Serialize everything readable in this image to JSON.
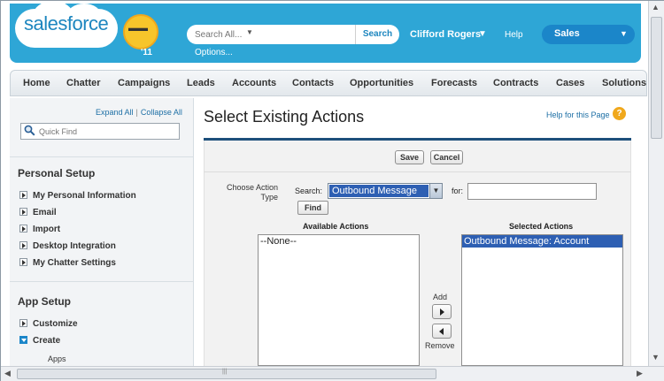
{
  "header": {
    "logo_text": "salesforce",
    "logo_year": "'11",
    "search_placeholder": "Search All...",
    "search_button": "Search",
    "options_link": "Options...",
    "user_name": "Clifford Rogers",
    "help_link": "Help",
    "app_picker": "Sales"
  },
  "tabs": [
    "Home",
    "Chatter",
    "Campaigns",
    "Leads",
    "Accounts",
    "Contacts",
    "Opportunities",
    "Forecasts",
    "Contracts",
    "Cases",
    "Solutions"
  ],
  "sidebar": {
    "expand_all": "Expand All",
    "separator": "|",
    "collapse_all": "Collapse All",
    "quick_find_placeholder": "Quick Find",
    "personal_setup": {
      "title": "Personal Setup",
      "items": [
        "My Personal Information",
        "Email",
        "Import",
        "Desktop Integration",
        "My Chatter Settings"
      ]
    },
    "app_setup": {
      "title": "App Setup",
      "items": [
        "Customize",
        "Create"
      ],
      "sub_items": [
        "Apps"
      ]
    }
  },
  "main": {
    "title": "Select Existing Actions",
    "help_link": "Help for this Page",
    "help_icon": "?",
    "save_button": "Save",
    "cancel_button": "Cancel",
    "choose_label": "Choose Action Type",
    "search_label": "Search:",
    "search_select_value": "Outbound Message",
    "for_label": "for:",
    "for_value": "",
    "find_button": "Find",
    "available_header": "Available Actions",
    "available_options": [
      "--None--"
    ],
    "selected_header": "Selected Actions",
    "selected_options": [
      "Outbound Message: Account"
    ],
    "add_label": "Add",
    "remove_label": "Remove"
  },
  "colors": {
    "header_blue": "#2ea6d6",
    "app_picker_blue": "#1b86c9",
    "selection_blue": "#2d5fb3",
    "title_rule": "#1d4f7b",
    "help_orange": "#f0a81c"
  },
  "icons": {
    "search": "magnifier-icon",
    "help": "help-icon",
    "add": "arrow-right-icon",
    "remove": "arrow-left-icon"
  }
}
